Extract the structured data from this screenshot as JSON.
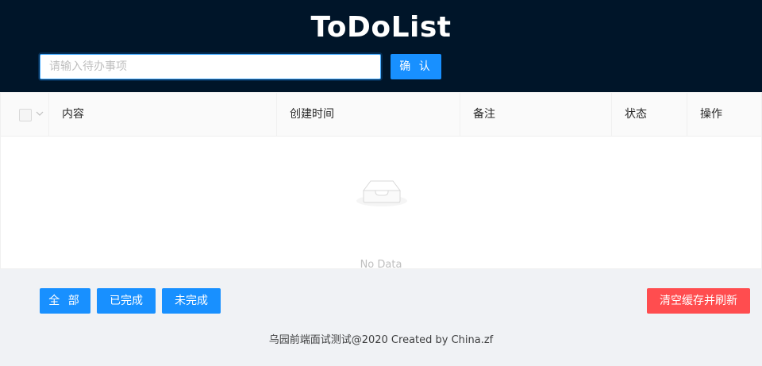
{
  "header": {
    "title": "ToDoList",
    "input_placeholder": "请输入待办事项",
    "input_value": "",
    "confirm_label": "确 认"
  },
  "table": {
    "columns": [
      "内容",
      "创建时间",
      "备注",
      "状态",
      "操作"
    ],
    "rows": [],
    "empty_text": "No Data"
  },
  "filters": {
    "all_label": "全 部",
    "done_label": "已完成",
    "undone_label": "未完成"
  },
  "actions": {
    "clear_label": "清空缓存并刷新"
  },
  "footer": {
    "text": "乌园前端面试测试@2020 Created by China.zf"
  },
  "colors": {
    "header_bg": "#001529",
    "primary": "#1890ff",
    "danger": "#ff4d4f",
    "page_bg": "#f0f2f5"
  },
  "icons": {
    "empty": "inbox-icon",
    "select_dropdown": "chevron-down-icon"
  }
}
